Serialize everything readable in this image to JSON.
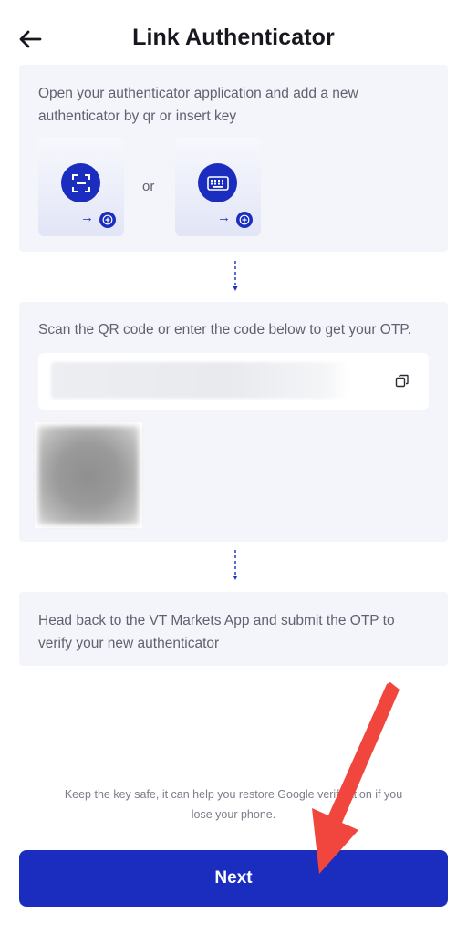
{
  "header": {
    "title": "Link Authenticator"
  },
  "step1": {
    "text": "Open your authenticator application and add a new authenticator by qr or insert key",
    "options": [
      {
        "icon": "qr-scan-icon"
      },
      {
        "icon": "keyboard-icon"
      }
    ],
    "separator": "or"
  },
  "step2": {
    "text": "Scan the QR code or enter the code below to get your OTP."
  },
  "step3": {
    "text": "Head back to the VT Markets App and submit the OTP to verify your new authenticator"
  },
  "footer": {
    "note": "Keep the key safe, it can help you restore Google verification if you lose your phone.",
    "next_label": "Next"
  },
  "colors": {
    "primary": "#1a2dbe",
    "card_bg": "#f4f5fa",
    "annotation_red": "#f0463e"
  }
}
